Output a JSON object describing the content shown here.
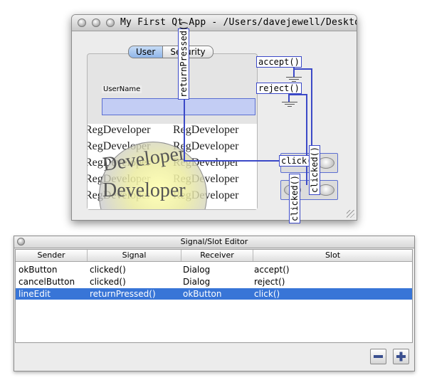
{
  "window": {
    "title": "My First Qt App - /Users/davejewell/Desktop/Re...",
    "tabs": [
      "User",
      "Security"
    ],
    "username_label": "UserName",
    "image_text": "RegDeveloper",
    "lens_text": "Developer"
  },
  "connections": {
    "accept_slot": "accept()",
    "reject_slot": "reject()",
    "click_slot": "click()",
    "return_signal": "returnPressed()",
    "clicked_signal_a": "clicked()",
    "clicked_signal_b": "clicked()"
  },
  "editor": {
    "title": "Signal/Slot Editor",
    "columns": [
      "Sender",
      "Signal",
      "Receiver",
      "Slot"
    ],
    "rows": [
      {
        "sender": "okButton",
        "signal": "clicked()",
        "receiver": "Dialog",
        "slot": "accept()"
      },
      {
        "sender": "cancelButton",
        "signal": "clicked()",
        "receiver": "Dialog",
        "slot": "reject()"
      },
      {
        "sender": "lineEdit",
        "signal": "returnPressed()",
        "receiver": "okButton",
        "slot": "click()"
      }
    ],
    "selected_row": 2,
    "remove_icon": "minus-icon",
    "add_icon": "plus-icon",
    "accent_color": "#3875d7",
    "connection_color": "#3b49c7"
  }
}
